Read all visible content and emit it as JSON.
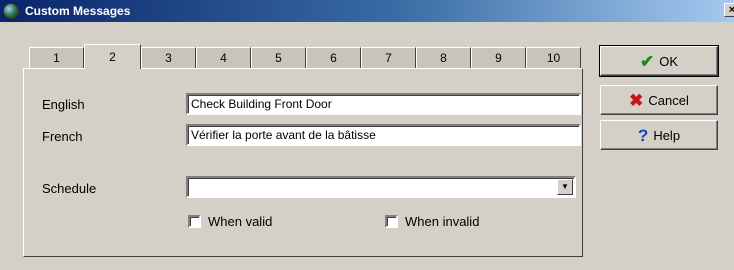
{
  "window": {
    "title": "Custom Messages",
    "close_label": "×"
  },
  "tabs": [
    {
      "label": "1",
      "active": false
    },
    {
      "label": "2",
      "active": true
    },
    {
      "label": "3",
      "active": false
    },
    {
      "label": "4",
      "active": false
    },
    {
      "label": "5",
      "active": false
    },
    {
      "label": "6",
      "active": false
    },
    {
      "label": "7",
      "active": false
    },
    {
      "label": "8",
      "active": false
    },
    {
      "label": "9",
      "active": false
    },
    {
      "label": "10",
      "active": false
    }
  ],
  "form": {
    "english_label": "English",
    "english_value": "Check Building Front Door",
    "french_label": "French",
    "french_value": "Vérifier la porte avant de la bâtisse",
    "schedule_label": "Schedule",
    "schedule_value": "",
    "when_valid_label": "When valid",
    "when_invalid_label": "When invalid"
  },
  "buttons": {
    "ok_label": "OK",
    "cancel_label": "Cancel",
    "help_label": "Help"
  },
  "icons": {
    "ok": "checkmark-icon",
    "cancel": "x-icon",
    "help": "question-icon"
  },
  "colors": {
    "ok_icon": "#1f8a1f",
    "cancel_icon": "#c01818",
    "help_icon": "#1a3fc0"
  }
}
